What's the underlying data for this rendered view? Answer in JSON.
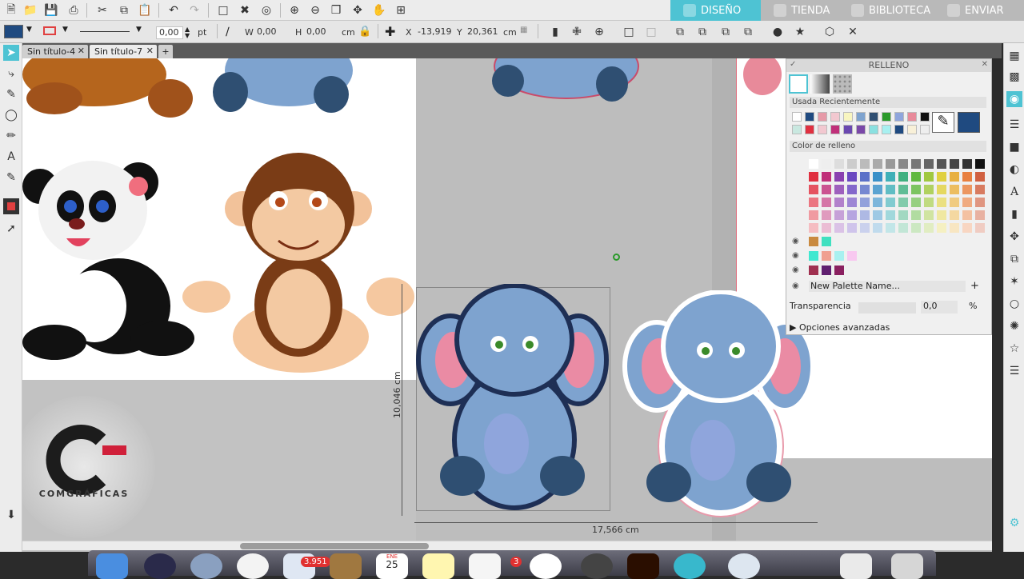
{
  "top_tabs": [
    {
      "label": "DISEÑO",
      "active": true
    },
    {
      "label": "TIENDA",
      "active": false
    },
    {
      "label": "BIBLIOTECA",
      "active": false
    },
    {
      "label": "ENVIAR",
      "active": false
    }
  ],
  "toolbar": {
    "line_width": "0,00",
    "line_unit": "pt",
    "w_label": "W",
    "w_value": "0,00",
    "h_label": "H",
    "h_value": "0,00",
    "size_unit": "cm",
    "x_label": "X",
    "x_value": "-13,919",
    "y_label": "Y",
    "y_value": "20,361",
    "pos_unit": "cm"
  },
  "doc_tabs": [
    {
      "label": "Sin título-4",
      "active": false
    },
    {
      "label": "Sin título-7",
      "active": true
    }
  ],
  "new_tab_label": "+",
  "fill_panel": {
    "title": "RELLENO",
    "recent_label": "Usada Recientemente",
    "fill_color_label": "Color de relleno",
    "new_palette_label": "New Palette Name...",
    "transparency_label": "Transparencia",
    "transparency_value": "0,0",
    "transparency_unit": "%",
    "advanced_label": "Opciones avanzadas"
  },
  "canvas": {
    "width_dim": "17,566 cm",
    "height_dim": "10,046 cm",
    "logo_text": "COMGRÁFICAS"
  },
  "dock": {
    "calendar_month": "ENE",
    "calendar_day": "25",
    "badge_mail": "3.951",
    "badge_reminders": "3"
  },
  "colors": {
    "accent_tab": "#4ec3d3",
    "tab_inactive": "#b9b9b9",
    "selected_fill": "#1f4a80"
  }
}
